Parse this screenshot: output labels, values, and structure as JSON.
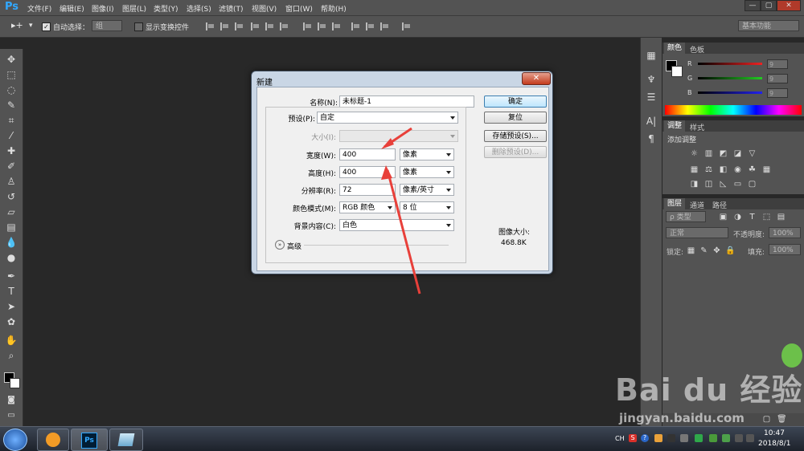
{
  "app": {
    "logo": "Ps"
  },
  "menu": [
    "文件(F)",
    "编辑(E)",
    "图像(I)",
    "图层(L)",
    "类型(Y)",
    "选择(S)",
    "滤镜(T)",
    "视图(V)",
    "窗口(W)",
    "帮助(H)"
  ],
  "window_buttons": [
    "—",
    "▢",
    "✕"
  ],
  "options": {
    "auto_select_label": "自动选择：",
    "auto_select_value": "组",
    "show_transform_label": "显示变换控件",
    "workspace": "基本功能"
  },
  "panels": {
    "color_tabs": [
      "颜色",
      "色板"
    ],
    "color_channels": [
      {
        "label": "R",
        "value": "9",
        "color": "#e22"
      },
      {
        "label": "G",
        "value": "9",
        "color": "#2c2"
      },
      {
        "label": "B",
        "value": "9",
        "color": "#22e"
      }
    ],
    "adjust_tabs": [
      "调整",
      "样式"
    ],
    "adjust_heading": "添加调整",
    "layers_tabs": [
      "图层",
      "通道",
      "路径"
    ],
    "layers_kind": "ρ 类型",
    "blend_mode": "正常",
    "opacity_label": "不透明度:",
    "opacity_value": "100%",
    "lock_label": "锁定:",
    "fill_label": "填充:",
    "fill_value": "100%"
  },
  "dialog": {
    "title": "新建",
    "close": "✕",
    "name_label": "名称(N):",
    "name_value": "未标题-1",
    "preset_label": "预设(P):",
    "preset_value": "自定",
    "size_label": "大小(I):",
    "width_label": "宽度(W):",
    "width_value": "400",
    "width_unit": "像素",
    "height_label": "高度(H):",
    "height_value": "400",
    "height_unit": "像素",
    "resolution_label": "分辨率(R):",
    "resolution_value": "72",
    "resolution_unit": "像素/英寸",
    "colormode_label": "颜色模式(M):",
    "colormode_value": "RGB 颜色",
    "bitdepth_value": "8 位",
    "bg_label": "背景内容(C):",
    "bg_value": "白色",
    "advanced_label": "高级",
    "buttons": {
      "ok": "确定",
      "reset": "复位",
      "save_preset": "存储预设(S)...",
      "delete_preset": "删除预设(D)..."
    },
    "image_size_label": "图像大小:",
    "image_size_value": "468.8K"
  },
  "taskbar": {
    "time": "10:47",
    "date": "2018/8/1",
    "lang": "CH",
    "ps_label": "Ps"
  },
  "watermark": {
    "brand": "Bai du 经验",
    "url": "jingyan.baidu.com"
  }
}
